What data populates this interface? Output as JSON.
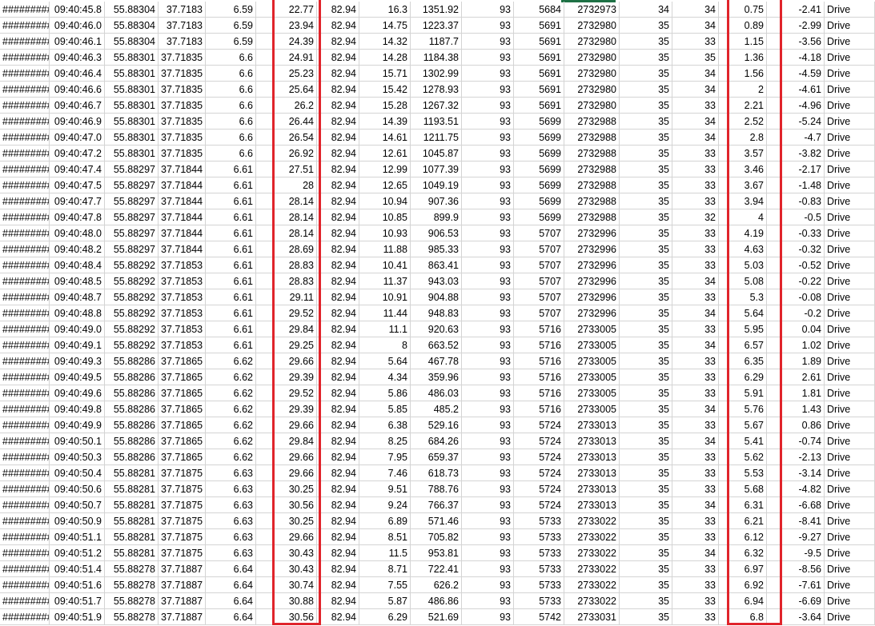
{
  "sheet": {
    "rows": [
      [
        "#########",
        "09:40:45.8",
        "55.88304",
        "37.7183",
        "6.59",
        "22.77",
        "82.94",
        "16.3",
        "1351.92",
        "93",
        "5684",
        "2732973",
        "34",
        "34",
        "0.75",
        "-2.41",
        "Drive"
      ],
      [
        "#########",
        "09:40:46.0",
        "55.88304",
        "37.7183",
        "6.59",
        "23.94",
        "82.94",
        "14.75",
        "1223.37",
        "93",
        "5691",
        "2732980",
        "35",
        "34",
        "0.89",
        "-2.99",
        "Drive"
      ],
      [
        "#########",
        "09:40:46.1",
        "55.88304",
        "37.7183",
        "6.59",
        "24.39",
        "82.94",
        "14.32",
        "1187.7",
        "93",
        "5691",
        "2732980",
        "35",
        "33",
        "1.15",
        "-3.56",
        "Drive"
      ],
      [
        "#########",
        "09:40:46.3",
        "55.88301",
        "37.71835",
        "6.6",
        "24.91",
        "82.94",
        "14.28",
        "1184.38",
        "93",
        "5691",
        "2732980",
        "35",
        "35",
        "1.36",
        "-4.18",
        "Drive"
      ],
      [
        "#########",
        "09:40:46.4",
        "55.88301",
        "37.71835",
        "6.6",
        "25.23",
        "82.94",
        "15.71",
        "1302.99",
        "93",
        "5691",
        "2732980",
        "35",
        "34",
        "1.56",
        "-4.59",
        "Drive"
      ],
      [
        "#########",
        "09:40:46.6",
        "55.88301",
        "37.71835",
        "6.6",
        "25.64",
        "82.94",
        "15.42",
        "1278.93",
        "93",
        "5691",
        "2732980",
        "35",
        "34",
        "2",
        "-4.61",
        "Drive"
      ],
      [
        "#########",
        "09:40:46.7",
        "55.88301",
        "37.71835",
        "6.6",
        "26.2",
        "82.94",
        "15.28",
        "1267.32",
        "93",
        "5691",
        "2732980",
        "35",
        "33",
        "2.21",
        "-4.96",
        "Drive"
      ],
      [
        "#########",
        "09:40:46.9",
        "55.88301",
        "37.71835",
        "6.6",
        "26.44",
        "82.94",
        "14.39",
        "1193.51",
        "93",
        "5699",
        "2732988",
        "35",
        "34",
        "2.52",
        "-5.24",
        "Drive"
      ],
      [
        "#########",
        "09:40:47.0",
        "55.88301",
        "37.71835",
        "6.6",
        "26.54",
        "82.94",
        "14.61",
        "1211.75",
        "93",
        "5699",
        "2732988",
        "35",
        "34",
        "2.8",
        "-4.7",
        "Drive"
      ],
      [
        "#########",
        "09:40:47.2",
        "55.88301",
        "37.71835",
        "6.6",
        "26.92",
        "82.94",
        "12.61",
        "1045.87",
        "93",
        "5699",
        "2732988",
        "35",
        "33",
        "3.57",
        "-3.82",
        "Drive"
      ],
      [
        "#########",
        "09:40:47.4",
        "55.88297",
        "37.71844",
        "6.61",
        "27.51",
        "82.94",
        "12.99",
        "1077.39",
        "93",
        "5699",
        "2732988",
        "35",
        "33",
        "3.46",
        "-2.17",
        "Drive"
      ],
      [
        "#########",
        "09:40:47.5",
        "55.88297",
        "37.71844",
        "6.61",
        "28",
        "82.94",
        "12.65",
        "1049.19",
        "93",
        "5699",
        "2732988",
        "35",
        "33",
        "3.67",
        "-1.48",
        "Drive"
      ],
      [
        "#########",
        "09:40:47.7",
        "55.88297",
        "37.71844",
        "6.61",
        "28.14",
        "82.94",
        "10.94",
        "907.36",
        "93",
        "5699",
        "2732988",
        "35",
        "33",
        "3.94",
        "-0.83",
        "Drive"
      ],
      [
        "#########",
        "09:40:47.8",
        "55.88297",
        "37.71844",
        "6.61",
        "28.14",
        "82.94",
        "10.85",
        "899.9",
        "93",
        "5699",
        "2732988",
        "35",
        "32",
        "4",
        "-0.5",
        "Drive"
      ],
      [
        "#########",
        "09:40:48.0",
        "55.88297",
        "37.71844",
        "6.61",
        "28.14",
        "82.94",
        "10.93",
        "906.53",
        "93",
        "5707",
        "2732996",
        "35",
        "33",
        "4.19",
        "-0.33",
        "Drive"
      ],
      [
        "#########",
        "09:40:48.2",
        "55.88297",
        "37.71844",
        "6.61",
        "28.69",
        "82.94",
        "11.88",
        "985.33",
        "93",
        "5707",
        "2732996",
        "35",
        "33",
        "4.63",
        "-0.32",
        "Drive"
      ],
      [
        "#########",
        "09:40:48.4",
        "55.88292",
        "37.71853",
        "6.61",
        "28.83",
        "82.94",
        "10.41",
        "863.41",
        "93",
        "5707",
        "2732996",
        "35",
        "33",
        "5.03",
        "-0.52",
        "Drive"
      ],
      [
        "#########",
        "09:40:48.5",
        "55.88292",
        "37.71853",
        "6.61",
        "28.83",
        "82.94",
        "11.37",
        "943.03",
        "93",
        "5707",
        "2732996",
        "35",
        "34",
        "5.08",
        "-0.22",
        "Drive"
      ],
      [
        "#########",
        "09:40:48.7",
        "55.88292",
        "37.71853",
        "6.61",
        "29.11",
        "82.94",
        "10.91",
        "904.88",
        "93",
        "5707",
        "2732996",
        "35",
        "33",
        "5.3",
        "-0.08",
        "Drive"
      ],
      [
        "#########",
        "09:40:48.8",
        "55.88292",
        "37.71853",
        "6.61",
        "29.52",
        "82.94",
        "11.44",
        "948.83",
        "93",
        "5707",
        "2732996",
        "35",
        "34",
        "5.64",
        "-0.2",
        "Drive"
      ],
      [
        "#########",
        "09:40:49.0",
        "55.88292",
        "37.71853",
        "6.61",
        "29.84",
        "82.94",
        "11.1",
        "920.63",
        "93",
        "5716",
        "2733005",
        "35",
        "33",
        "5.95",
        "0.04",
        "Drive"
      ],
      [
        "#########",
        "09:40:49.1",
        "55.88292",
        "37.71853",
        "6.61",
        "29.25",
        "82.94",
        "8",
        "663.52",
        "93",
        "5716",
        "2733005",
        "35",
        "34",
        "6.57",
        "1.02",
        "Drive"
      ],
      [
        "#########",
        "09:40:49.3",
        "55.88286",
        "37.71865",
        "6.62",
        "29.66",
        "82.94",
        "5.64",
        "467.78",
        "93",
        "5716",
        "2733005",
        "35",
        "33",
        "6.35",
        "1.89",
        "Drive"
      ],
      [
        "#########",
        "09:40:49.5",
        "55.88286",
        "37.71865",
        "6.62",
        "29.39",
        "82.94",
        "4.34",
        "359.96",
        "93",
        "5716",
        "2733005",
        "35",
        "33",
        "6.29",
        "2.61",
        "Drive"
      ],
      [
        "#########",
        "09:40:49.6",
        "55.88286",
        "37.71865",
        "6.62",
        "29.52",
        "82.94",
        "5.86",
        "486.03",
        "93",
        "5716",
        "2733005",
        "35",
        "33",
        "5.91",
        "1.81",
        "Drive"
      ],
      [
        "#########",
        "09:40:49.8",
        "55.88286",
        "37.71865",
        "6.62",
        "29.39",
        "82.94",
        "5.85",
        "485.2",
        "93",
        "5716",
        "2733005",
        "35",
        "34",
        "5.76",
        "1.43",
        "Drive"
      ],
      [
        "#########",
        "09:40:49.9",
        "55.88286",
        "37.71865",
        "6.62",
        "29.66",
        "82.94",
        "6.38",
        "529.16",
        "93",
        "5724",
        "2733013",
        "35",
        "33",
        "5.67",
        "0.86",
        "Drive"
      ],
      [
        "#########",
        "09:40:50.1",
        "55.88286",
        "37.71865",
        "6.62",
        "29.84",
        "82.94",
        "8.25",
        "684.26",
        "93",
        "5724",
        "2733013",
        "35",
        "34",
        "5.41",
        "-0.74",
        "Drive"
      ],
      [
        "#########",
        "09:40:50.3",
        "55.88286",
        "37.71865",
        "6.62",
        "29.66",
        "82.94",
        "7.95",
        "659.37",
        "93",
        "5724",
        "2733013",
        "35",
        "33",
        "5.62",
        "-2.13",
        "Drive"
      ],
      [
        "#########",
        "09:40:50.4",
        "55.88281",
        "37.71875",
        "6.63",
        "29.66",
        "82.94",
        "7.46",
        "618.73",
        "93",
        "5724",
        "2733013",
        "35",
        "33",
        "5.53",
        "-3.14",
        "Drive"
      ],
      [
        "#########",
        "09:40:50.6",
        "55.88281",
        "37.71875",
        "6.63",
        "30.25",
        "82.94",
        "9.51",
        "788.76",
        "93",
        "5724",
        "2733013",
        "35",
        "33",
        "5.68",
        "-4.82",
        "Drive"
      ],
      [
        "#########",
        "09:40:50.7",
        "55.88281",
        "37.71875",
        "6.63",
        "30.56",
        "82.94",
        "9.24",
        "766.37",
        "93",
        "5724",
        "2733013",
        "35",
        "34",
        "6.31",
        "-6.68",
        "Drive"
      ],
      [
        "#########",
        "09:40:50.9",
        "55.88281",
        "37.71875",
        "6.63",
        "30.25",
        "82.94",
        "6.89",
        "571.46",
        "93",
        "5733",
        "2733022",
        "35",
        "33",
        "6.21",
        "-8.41",
        "Drive"
      ],
      [
        "#########",
        "09:40:51.1",
        "55.88281",
        "37.71875",
        "6.63",
        "29.66",
        "82.94",
        "8.51",
        "705.82",
        "93",
        "5733",
        "2733022",
        "35",
        "33",
        "6.12",
        "-9.27",
        "Drive"
      ],
      [
        "#########",
        "09:40:51.2",
        "55.88281",
        "37.71875",
        "6.63",
        "30.43",
        "82.94",
        "11.5",
        "953.81",
        "93",
        "5733",
        "2733022",
        "35",
        "34",
        "6.32",
        "-9.5",
        "Drive"
      ],
      [
        "#########",
        "09:40:51.4",
        "55.88278",
        "37.71887",
        "6.64",
        "30.43",
        "82.94",
        "8.71",
        "722.41",
        "93",
        "5733",
        "2733022",
        "35",
        "33",
        "6.97",
        "-8.56",
        "Drive"
      ],
      [
        "#########",
        "09:40:51.6",
        "55.88278",
        "37.71887",
        "6.64",
        "30.74",
        "82.94",
        "7.55",
        "626.2",
        "93",
        "5733",
        "2733022",
        "35",
        "33",
        "6.92",
        "-7.61",
        "Drive"
      ],
      [
        "#########",
        "09:40:51.7",
        "55.88278",
        "37.71887",
        "6.64",
        "30.88",
        "82.94",
        "5.87",
        "486.86",
        "93",
        "5733",
        "2733022",
        "35",
        "33",
        "6.94",
        "-6.69",
        "Drive"
      ],
      [
        "#########",
        "09:40:51.9",
        "55.88278",
        "37.71887",
        "6.64",
        "30.56",
        "82.94",
        "6.29",
        "521.69",
        "93",
        "5742",
        "2733031",
        "35",
        "33",
        "6.8",
        "-3.64",
        "Drive"
      ]
    ],
    "highlighted_columns": [
      5,
      14
    ],
    "highlight_color": "#e0242b",
    "grid_color": "#d4d4d4",
    "active_tab_color": "#1e7145"
  }
}
